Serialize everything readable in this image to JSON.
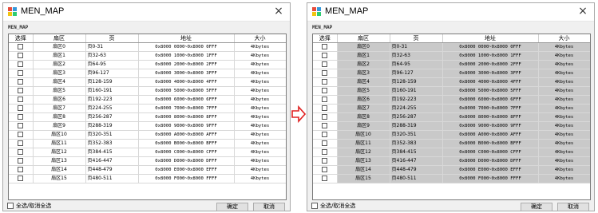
{
  "window_title": "MEN_MAP",
  "group_label": "MEN_MAP",
  "headers": [
    "选择",
    "扇区",
    "页",
    "地址",
    "大小"
  ],
  "rows": [
    {
      "sector": "扇区0",
      "page": "页0-31",
      "address": "0x8000 0000~0x8000 0FFF",
      "size": "4Kbytes"
    },
    {
      "sector": "扇区1",
      "page": "页32-63",
      "address": "0x8000 1000~0x8000 1FFF",
      "size": "4Kbytes"
    },
    {
      "sector": "扇区2",
      "page": "页64-95",
      "address": "0x8000 2000~0x8000 2FFF",
      "size": "4Kbytes"
    },
    {
      "sector": "扇区3",
      "page": "页96-127",
      "address": "0x8000 3000~0x8000 3FFF",
      "size": "4Kbytes"
    },
    {
      "sector": "扇区4",
      "page": "页128-159",
      "address": "0x8000 4000~0x8000 4FFF",
      "size": "4Kbytes"
    },
    {
      "sector": "扇区5",
      "page": "页160-191",
      "address": "0x8000 5000~0x8000 5FFF",
      "size": "4Kbytes"
    },
    {
      "sector": "扇区6",
      "page": "页192-223",
      "address": "0x8000 6000~0x8000 6FFF",
      "size": "4Kbytes"
    },
    {
      "sector": "扇区7",
      "page": "页224-255",
      "address": "0x8000 7000~0x8000 7FFF",
      "size": "4Kbytes"
    },
    {
      "sector": "扇区8",
      "page": "页256-287",
      "address": "0x8000 8000~0x8000 8FFF",
      "size": "4Kbytes"
    },
    {
      "sector": "扇区9",
      "page": "页288-319",
      "address": "0x8000 9000~0x8000 9FFF",
      "size": "4Kbytes"
    },
    {
      "sector": "扇区10",
      "page": "页320-351",
      "address": "0x8000 A000~0x8000 AFFF",
      "size": "4Kbytes"
    },
    {
      "sector": "扇区11",
      "page": "页352-383",
      "address": "0x8000 B000~0x8000 BFFF",
      "size": "4Kbytes"
    },
    {
      "sector": "扇区12",
      "page": "页384-415",
      "address": "0x8000 C000~0x8000 CFFF",
      "size": "4Kbytes"
    },
    {
      "sector": "扇区13",
      "page": "页416-447",
      "address": "0x8000 D000~0x8000 DFFF",
      "size": "4Kbytes"
    },
    {
      "sector": "扇区14",
      "page": "页448-479",
      "address": "0x8000 E000~0x8000 EFFF",
      "size": "4Kbytes"
    },
    {
      "sector": "扇区15",
      "page": "页480-511",
      "address": "0x8000 F000~0x8000 FFFF",
      "size": "4Kbytes"
    }
  ],
  "left_window_rows_selected": false,
  "right_window_rows_selected": true,
  "select_all_label": "全选/取消全选",
  "ok_label": "确定",
  "cancel_label": "取消",
  "close_glyph": "×",
  "arrow_color": "#e02020",
  "selected_row_color": "#c9c9c9"
}
